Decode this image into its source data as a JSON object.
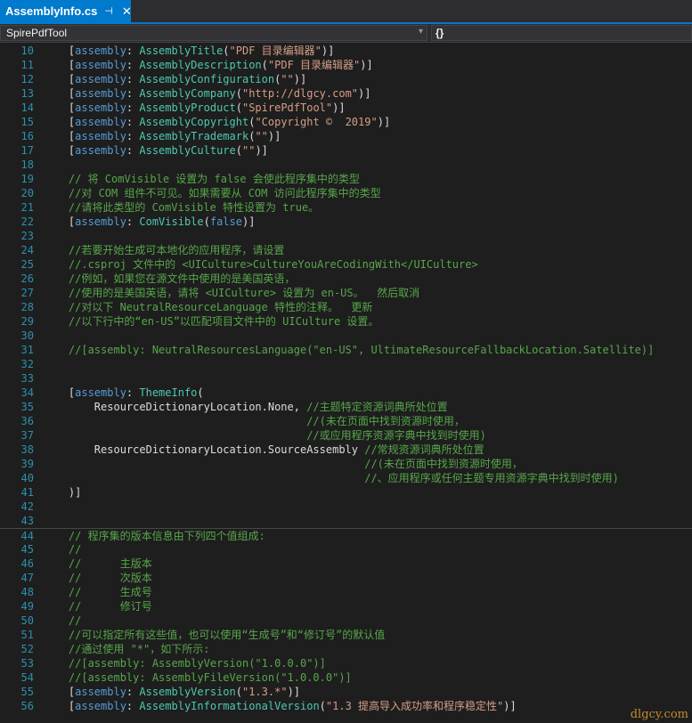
{
  "tab": {
    "title": "AssemblyInfo.cs",
    "pin_glyph": "⊣",
    "close_glyph": "✕"
  },
  "nav": {
    "project": "SpirePdfTool",
    "member": "{}"
  },
  "colors": {
    "comment": "#57a64a",
    "keyword": "#569cd6",
    "type": "#4ec9b0",
    "string": "#d69d85",
    "plain": "#dcdcdc",
    "line_number": "#2b91af"
  },
  "lines": [
    {
      "n": "10",
      "s": [
        {
          "c": "pl",
          "t": "    ["
        },
        {
          "c": "kw",
          "t": "assembly"
        },
        {
          "c": "pl",
          "t": ": "
        },
        {
          "c": "ty",
          "t": "AssemblyTitle"
        },
        {
          "c": "pl",
          "t": "("
        },
        {
          "c": "st",
          "t": "\"PDF 目录编辑器\""
        },
        {
          "c": "pl",
          "t": ")]"
        }
      ]
    },
    {
      "n": "11",
      "s": [
        {
          "c": "pl",
          "t": "    ["
        },
        {
          "c": "kw",
          "t": "assembly"
        },
        {
          "c": "pl",
          "t": ": "
        },
        {
          "c": "ty",
          "t": "AssemblyDescription"
        },
        {
          "c": "pl",
          "t": "("
        },
        {
          "c": "st",
          "t": "\"PDF 目录编辑器\""
        },
        {
          "c": "pl",
          "t": ")]"
        }
      ]
    },
    {
      "n": "12",
      "s": [
        {
          "c": "pl",
          "t": "    ["
        },
        {
          "c": "kw",
          "t": "assembly"
        },
        {
          "c": "pl",
          "t": ": "
        },
        {
          "c": "ty",
          "t": "AssemblyConfiguration"
        },
        {
          "c": "pl",
          "t": "("
        },
        {
          "c": "st",
          "t": "\"\""
        },
        {
          "c": "pl",
          "t": ")]"
        }
      ]
    },
    {
      "n": "13",
      "s": [
        {
          "c": "pl",
          "t": "    ["
        },
        {
          "c": "kw",
          "t": "assembly"
        },
        {
          "c": "pl",
          "t": ": "
        },
        {
          "c": "ty",
          "t": "AssemblyCompany"
        },
        {
          "c": "pl",
          "t": "("
        },
        {
          "c": "st",
          "t": "\"http://dlgcy.com\""
        },
        {
          "c": "pl",
          "t": ")]"
        }
      ]
    },
    {
      "n": "14",
      "s": [
        {
          "c": "pl",
          "t": "    ["
        },
        {
          "c": "kw",
          "t": "assembly"
        },
        {
          "c": "pl",
          "t": ": "
        },
        {
          "c": "ty",
          "t": "AssemblyProduct"
        },
        {
          "c": "pl",
          "t": "("
        },
        {
          "c": "st",
          "t": "\"SpirePdfTool\""
        },
        {
          "c": "pl",
          "t": ")]"
        }
      ]
    },
    {
      "n": "15",
      "s": [
        {
          "c": "pl",
          "t": "    ["
        },
        {
          "c": "kw",
          "t": "assembly"
        },
        {
          "c": "pl",
          "t": ": "
        },
        {
          "c": "ty",
          "t": "AssemblyCopyright"
        },
        {
          "c": "pl",
          "t": "("
        },
        {
          "c": "st",
          "t": "\"Copyright ©  2019\""
        },
        {
          "c": "pl",
          "t": ")]"
        }
      ]
    },
    {
      "n": "16",
      "s": [
        {
          "c": "pl",
          "t": "    ["
        },
        {
          "c": "kw",
          "t": "assembly"
        },
        {
          "c": "pl",
          "t": ": "
        },
        {
          "c": "ty",
          "t": "AssemblyTrademark"
        },
        {
          "c": "pl",
          "t": "("
        },
        {
          "c": "st",
          "t": "\"\""
        },
        {
          "c": "pl",
          "t": ")]"
        }
      ]
    },
    {
      "n": "17",
      "s": [
        {
          "c": "pl",
          "t": "    ["
        },
        {
          "c": "kw",
          "t": "assembly"
        },
        {
          "c": "pl",
          "t": ": "
        },
        {
          "c": "ty",
          "t": "AssemblyCulture"
        },
        {
          "c": "pl",
          "t": "("
        },
        {
          "c": "st",
          "t": "\"\""
        },
        {
          "c": "pl",
          "t": ")]"
        }
      ]
    },
    {
      "n": "18",
      "s": []
    },
    {
      "n": "19",
      "s": [
        {
          "c": "cm",
          "t": "    // 将 ComVisible 设置为 false 会使此程序集中的类型"
        }
      ]
    },
    {
      "n": "20",
      "s": [
        {
          "c": "cm",
          "t": "    //对 COM 组件不可见。如果需要从 COM 访问此程序集中的类型"
        }
      ]
    },
    {
      "n": "21",
      "s": [
        {
          "c": "cm",
          "t": "    //请将此类型的 ComVisible 特性设置为 true。"
        }
      ]
    },
    {
      "n": "22",
      "s": [
        {
          "c": "pl",
          "t": "    ["
        },
        {
          "c": "kw",
          "t": "assembly"
        },
        {
          "c": "pl",
          "t": ": "
        },
        {
          "c": "ty",
          "t": "ComVisible"
        },
        {
          "c": "pl",
          "t": "("
        },
        {
          "c": "kw",
          "t": "false"
        },
        {
          "c": "pl",
          "t": ")]"
        }
      ]
    },
    {
      "n": "23",
      "s": []
    },
    {
      "n": "24",
      "s": [
        {
          "c": "cm",
          "t": "    //若要开始生成可本地化的应用程序，请设置"
        }
      ]
    },
    {
      "n": "25",
      "s": [
        {
          "c": "cm",
          "t": "    //.csproj 文件中的 <UICulture>CultureYouAreCodingWith</UICulture>"
        }
      ]
    },
    {
      "n": "26",
      "s": [
        {
          "c": "cm",
          "t": "    //例如，如果您在源文件中使用的是美国英语，"
        }
      ]
    },
    {
      "n": "27",
      "s": [
        {
          "c": "cm",
          "t": "    //使用的是美国英语，请将 <UICulture> 设置为 en-US。  然后取消"
        }
      ]
    },
    {
      "n": "28",
      "s": [
        {
          "c": "cm",
          "t": "    //对以下 NeutralResourceLanguage 特性的注释。  更新"
        }
      ]
    },
    {
      "n": "29",
      "s": [
        {
          "c": "cm",
          "t": "    //以下行中的“en-US”以匹配项目文件中的 UICulture 设置。"
        }
      ]
    },
    {
      "n": "30",
      "s": []
    },
    {
      "n": "31",
      "s": [
        {
          "c": "cm",
          "t": "    //[assembly: NeutralResourcesLanguage(\"en-US\", UltimateResourceFallbackLocation.Satellite)]"
        }
      ]
    },
    {
      "n": "32",
      "s": []
    },
    {
      "n": "33",
      "s": []
    },
    {
      "n": "34",
      "s": [
        {
          "c": "pl",
          "t": "    ["
        },
        {
          "c": "kw",
          "t": "assembly"
        },
        {
          "c": "pl",
          "t": ": "
        },
        {
          "c": "ty",
          "t": "ThemeInfo"
        },
        {
          "c": "pl",
          "t": "("
        }
      ]
    },
    {
      "n": "35",
      "s": [
        {
          "c": "pl",
          "t": "        ResourceDictionaryLocation.None, "
        },
        {
          "c": "cm",
          "t": "//主题特定资源词典所处位置"
        }
      ]
    },
    {
      "n": "36",
      "s": [
        {
          "c": "cm",
          "t": "                                         //(未在页面中找到资源时使用，"
        }
      ]
    },
    {
      "n": "37",
      "s": [
        {
          "c": "cm",
          "t": "                                         //或应用程序资源字典中找到时使用)"
        }
      ]
    },
    {
      "n": "38",
      "s": [
        {
          "c": "pl",
          "t": "        ResourceDictionaryLocation.SourceAssembly "
        },
        {
          "c": "cm",
          "t": "//常规资源词典所处位置"
        }
      ]
    },
    {
      "n": "39",
      "s": [
        {
          "c": "cm",
          "t": "                                                  //(未在页面中找到资源时使用，"
        }
      ]
    },
    {
      "n": "40",
      "s": [
        {
          "c": "cm",
          "t": "                                                  //、应用程序或任何主题专用资源字典中找到时使用)"
        }
      ]
    },
    {
      "n": "41",
      "s": [
        {
          "c": "pl",
          "t": "    )]"
        }
      ]
    },
    {
      "n": "42",
      "s": []
    },
    {
      "n": "43",
      "s": []
    },
    {
      "n": "44",
      "hl": true,
      "s": [
        {
          "c": "cm",
          "t": "    // 程序集的版本信息由下列四个值组成:"
        }
      ]
    },
    {
      "n": "45",
      "s": [
        {
          "c": "cm",
          "t": "    //"
        }
      ]
    },
    {
      "n": "46",
      "s": [
        {
          "c": "cm",
          "t": "    //      主版本"
        }
      ]
    },
    {
      "n": "47",
      "s": [
        {
          "c": "cm",
          "t": "    //      次版本"
        }
      ]
    },
    {
      "n": "48",
      "s": [
        {
          "c": "cm",
          "t": "    //      生成号"
        }
      ]
    },
    {
      "n": "49",
      "s": [
        {
          "c": "cm",
          "t": "    //      修订号"
        }
      ]
    },
    {
      "n": "50",
      "s": [
        {
          "c": "cm",
          "t": "    //"
        }
      ]
    },
    {
      "n": "51",
      "s": [
        {
          "c": "cm",
          "t": "    //可以指定所有这些值，也可以使用“生成号”和“修订号”的默认值"
        }
      ]
    },
    {
      "n": "52",
      "s": [
        {
          "c": "cm",
          "t": "    //通过使用 \"*\"，如下所示:"
        }
      ]
    },
    {
      "n": "53",
      "s": [
        {
          "c": "cm",
          "t": "    //[assembly: AssemblyVersion(\"1.0.0.0\")]"
        }
      ]
    },
    {
      "n": "54",
      "s": [
        {
          "c": "cm",
          "t": "    //[assembly: AssemblyFileVersion(\"1.0.0.0\")]"
        }
      ]
    },
    {
      "n": "55",
      "s": [
        {
          "c": "pl",
          "t": "    ["
        },
        {
          "c": "kw",
          "t": "assembly"
        },
        {
          "c": "pl",
          "t": ": "
        },
        {
          "c": "ty",
          "t": "AssemblyVersion"
        },
        {
          "c": "pl",
          "t": "("
        },
        {
          "c": "st",
          "t": "\"1.3.*\""
        },
        {
          "c": "pl",
          "t": ")]"
        }
      ]
    },
    {
      "n": "56",
      "s": [
        {
          "c": "pl",
          "t": "    ["
        },
        {
          "c": "kw",
          "t": "assembly"
        },
        {
          "c": "pl",
          "t": ": "
        },
        {
          "c": "ty",
          "t": "AssemblyInformationalVersion"
        },
        {
          "c": "pl",
          "t": "("
        },
        {
          "c": "st",
          "t": "\"1.3 提高导入成功率和程序稳定性\""
        },
        {
          "c": "pl",
          "t": ")]"
        }
      ]
    }
  ],
  "watermark": "dlgcy.com"
}
